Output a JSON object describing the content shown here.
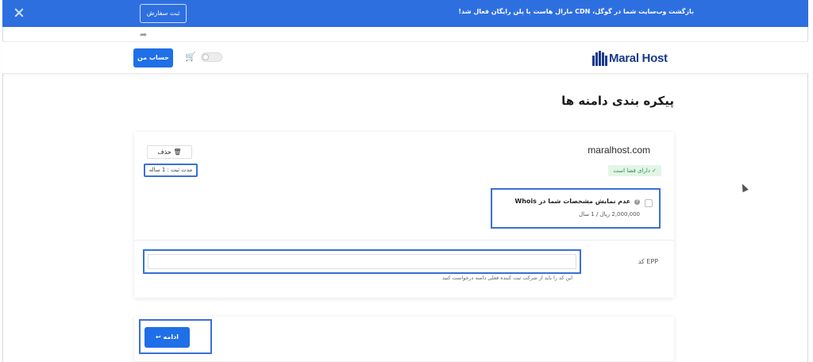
{
  "banner": {
    "text": "بازگشت وب‌سایت شما در گوگل، CDN مارال هاست با پلن رایگان فعال شد!",
    "order_label": "ثبت سفارش",
    "close_icon": "close-icon"
  },
  "share": {
    "icon": "share-arrow-icon"
  },
  "header": {
    "account_label": "حساب من",
    "cart_icon": "cart-icon",
    "toggle_label": "dark-mode-toggle",
    "logo_text": "Maral Host"
  },
  "page": {
    "title": "پیکره بندی دامنه ها"
  },
  "domain": {
    "name": "maralhost.com",
    "status": "دارای فضا است",
    "status_check": "✓",
    "delete_label": "حذف",
    "delete_icon": "trash-icon",
    "duration": "مدت ثبت : 1 ساله"
  },
  "whois": {
    "title": "عدم نمایش مشخصات شما در Whois",
    "info": "?",
    "price": "2,000,000 ریال / 1 سال"
  },
  "epp": {
    "label": "EPP کد",
    "value": "",
    "hint": "این کد را باید از شرکت ثبت کننده فعلی دامنه درخواست کنید"
  },
  "actions": {
    "continue_label": "ادامه",
    "continue_icon": "return-arrow-icon"
  },
  "colors": {
    "banner": "#2e6fe0",
    "primary": "#1f6fe8",
    "logo": "#173a8a",
    "highlight": "#3a6fd8",
    "success_bg": "#e2f6e6",
    "success_text": "#2f8a46"
  }
}
